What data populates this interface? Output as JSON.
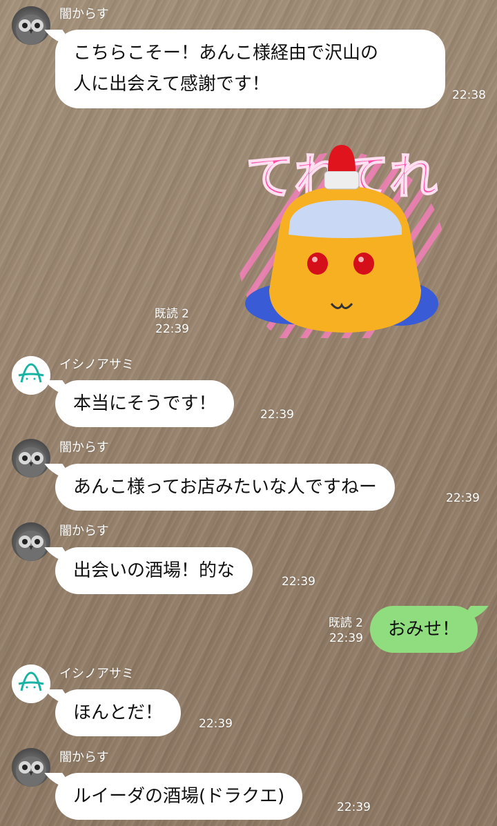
{
  "messages": [
    {
      "sender": "闇からす",
      "avatar": "owl-avatar",
      "text_lines": [
        "こちらこそー！あんこ様経由で沢山の",
        "人に出会えて感謝です！"
      ],
      "time": "22:38"
    },
    {
      "sender": "self",
      "type": "sticker",
      "sticker_text": "てれてれ",
      "read": "既読 2",
      "time": "22:39"
    },
    {
      "sender": "イシノアサミ",
      "avatar": "letter-a-avatar",
      "text": "本当にそうです！",
      "time": "22:39"
    },
    {
      "sender": "闇からす",
      "avatar": "owl-avatar",
      "text": "あんこ様ってお店みたいな人ですねー",
      "time": "22:39"
    },
    {
      "sender": "闇からす",
      "avatar": "owl-avatar",
      "text": "出会いの酒場！的な",
      "time": "22:39"
    },
    {
      "sender": "self",
      "text": "おみせ！",
      "read": "既読 2",
      "time": "22:39"
    },
    {
      "sender": "イシノアサミ",
      "avatar": "letter-a-avatar",
      "text": "ほんとだ！",
      "time": "22:39"
    },
    {
      "sender": "闇からす",
      "avatar": "owl-avatar",
      "text": "ルイーダの酒場(ドラクエ)",
      "time": "22:39"
    }
  ],
  "colors": {
    "outgoing_bubble": "#8fdd7f",
    "incoming_bubble": "#ffffff",
    "sticker_text": "#ff4fa8",
    "avatar_a": "#19b3a3"
  }
}
